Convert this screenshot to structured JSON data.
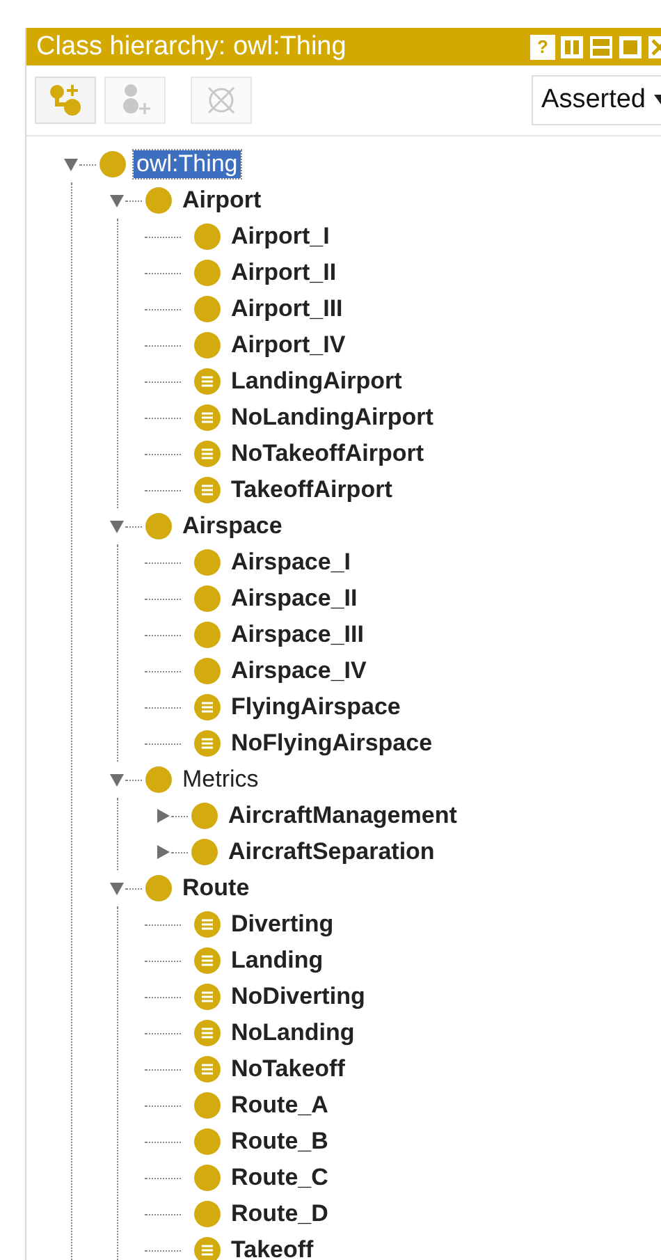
{
  "panel": {
    "title": "Class hierarchy: owl:Thing",
    "title_buttons": [
      "?"
    ]
  },
  "toolbar": {
    "buttons": [
      {
        "kind": "add-subclass",
        "disabled": false
      },
      {
        "kind": "add-sibling",
        "disabled": true
      },
      {
        "kind": "delete",
        "disabled": true
      }
    ],
    "view_select": {
      "value": "Asserted"
    }
  },
  "tree": [
    {
      "label": "owl:Thing",
      "kind": "primitive",
      "bold": false,
      "selected": true,
      "expanded": true,
      "children": [
        {
          "label": "Airport",
          "kind": "primitive",
          "bold": true,
          "selected": false,
          "expanded": true,
          "children": [
            {
              "label": "Airport_I",
              "kind": "primitive",
              "bold": true,
              "selected": false
            },
            {
              "label": "Airport_II",
              "kind": "primitive",
              "bold": true,
              "selected": false
            },
            {
              "label": "Airport_III",
              "kind": "primitive",
              "bold": true,
              "selected": false
            },
            {
              "label": "Airport_IV",
              "kind": "primitive",
              "bold": true,
              "selected": false
            },
            {
              "label": "LandingAirport",
              "kind": "defined",
              "bold": true,
              "selected": false
            },
            {
              "label": "NoLandingAirport",
              "kind": "defined",
              "bold": true,
              "selected": false
            },
            {
              "label": "NoTakeoffAirport",
              "kind": "defined",
              "bold": true,
              "selected": false
            },
            {
              "label": "TakeoffAirport",
              "kind": "defined",
              "bold": true,
              "selected": false
            }
          ]
        },
        {
          "label": "Airspace",
          "kind": "primitive",
          "bold": true,
          "selected": false,
          "expanded": true,
          "children": [
            {
              "label": "Airspace_I",
              "kind": "primitive",
              "bold": true,
              "selected": false
            },
            {
              "label": "Airspace_II",
              "kind": "primitive",
              "bold": true,
              "selected": false
            },
            {
              "label": "Airspace_III",
              "kind": "primitive",
              "bold": true,
              "selected": false
            },
            {
              "label": "Airspace_IV",
              "kind": "primitive",
              "bold": true,
              "selected": false
            },
            {
              "label": "FlyingAirspace",
              "kind": "defined",
              "bold": true,
              "selected": false
            },
            {
              "label": "NoFlyingAirspace",
              "kind": "defined",
              "bold": true,
              "selected": false
            }
          ]
        },
        {
          "label": "Metrics",
          "kind": "primitive",
          "bold": false,
          "selected": false,
          "expanded": true,
          "children": [
            {
              "label": "AircraftManagement",
              "kind": "primitive",
              "bold": true,
              "selected": false,
              "expanded": false
            },
            {
              "label": "AircraftSeparation",
              "kind": "primitive",
              "bold": true,
              "selected": false,
              "expanded": false
            }
          ]
        },
        {
          "label": "Route",
          "kind": "primitive",
          "bold": true,
          "selected": false,
          "expanded": true,
          "children": [
            {
              "label": "Diverting",
              "kind": "defined",
              "bold": true,
              "selected": false
            },
            {
              "label": "Landing",
              "kind": "defined",
              "bold": true,
              "selected": false
            },
            {
              "label": "NoDiverting",
              "kind": "defined",
              "bold": true,
              "selected": false
            },
            {
              "label": "NoLanding",
              "kind": "defined",
              "bold": true,
              "selected": false
            },
            {
              "label": "NoTakeoff",
              "kind": "defined",
              "bold": true,
              "selected": false
            },
            {
              "label": "Route_A",
              "kind": "primitive",
              "bold": true,
              "selected": false
            },
            {
              "label": "Route_B",
              "kind": "primitive",
              "bold": true,
              "selected": false
            },
            {
              "label": "Route_C",
              "kind": "primitive",
              "bold": true,
              "selected": false
            },
            {
              "label": "Route_D",
              "kind": "primitive",
              "bold": true,
              "selected": false
            },
            {
              "label": "Takeoff",
              "kind": "defined",
              "bold": true,
              "selected": false
            }
          ]
        }
      ]
    }
  ]
}
